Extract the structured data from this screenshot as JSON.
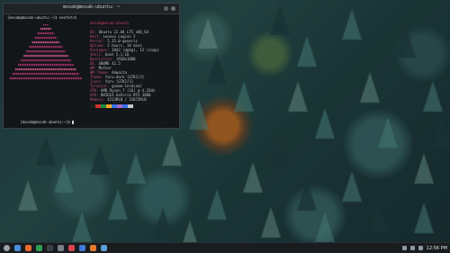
{
  "terminal": {
    "title": "mosab@mosab-ubuntu: ~",
    "prompt_top": "[mosab@mosab-ubuntu:~]$ neofetch",
    "prompt_bottom": "[mosab@mosab-ubuntu:~]$ ",
    "info_header": "mosab@mosab-ubuntu",
    "info": [
      {
        "k": "OS:",
        "v": " Ubuntu 22.04 LTS x86_64"
      },
      {
        "k": "Host:",
        "v": " Lenovo Legion 5"
      },
      {
        "k": "Kernel:",
        "v": " 5.15.0-generic"
      },
      {
        "k": "Uptime:",
        "v": " 2 hours, 14 mins"
      },
      {
        "k": "Packages:",
        "v": " 1842 (dpkg), 12 (snap)"
      },
      {
        "k": "Shell:",
        "v": " bash 5.1.16"
      },
      {
        "k": "Resolution:",
        "v": " 1920x1080"
      },
      {
        "k": "DE:",
        "v": " GNOME 42.5"
      },
      {
        "k": "WM:",
        "v": " Mutter"
      },
      {
        "k": "WM Theme:",
        "v": " Adwaita"
      },
      {
        "k": "Theme:",
        "v": " Yaru-dark [GTK2/3]"
      },
      {
        "k": "Icons:",
        "v": " Yaru [GTK2/3]"
      },
      {
        "k": "Terminal:",
        "v": " gnome-terminal"
      },
      {
        "k": "CPU:",
        "v": " AMD Ryzen 7 (16) @ 4.2GHz"
      },
      {
        "k": "GPU:",
        "v": " NVIDIA GeForce RTX 3060"
      },
      {
        "k": "Memory:",
        "v": " 4213MiB / 15872MiB"
      }
    ],
    "palette": [
      "#1d1f21",
      "#cc342b",
      "#198844",
      "#fba922",
      "#3971ed",
      "#a36ac7",
      "#3971ed",
      "#c5c8c6",
      "#969896",
      "#cc342b",
      "#198844",
      "#fba922",
      "#3971ed",
      "#a36ac7",
      "#3971ed",
      "#ffffff"
    ],
    "logo_color": "#a8326e",
    "logo_color2": "#c8558a"
  },
  "taskbar": {
    "apps": [
      {
        "name": "app-launcher-icon",
        "color": "#9aa3aa"
      },
      {
        "name": "files-icon",
        "color": "#4a90d9"
      },
      {
        "name": "browser-icon",
        "color": "#e66b2e"
      },
      {
        "name": "chrome-icon",
        "color": "#2e9d52"
      },
      {
        "name": "terminal-icon",
        "color": "#3b4046"
      },
      {
        "name": "settings-icon",
        "color": "#7a8087"
      },
      {
        "name": "music-icon",
        "color": "#d64550"
      },
      {
        "name": "editor-icon",
        "color": "#3f7bd6"
      },
      {
        "name": "store-icon",
        "color": "#e27a2d"
      },
      {
        "name": "mail-icon",
        "color": "#5a9bd8"
      }
    ],
    "clock": "12:56 PM"
  }
}
